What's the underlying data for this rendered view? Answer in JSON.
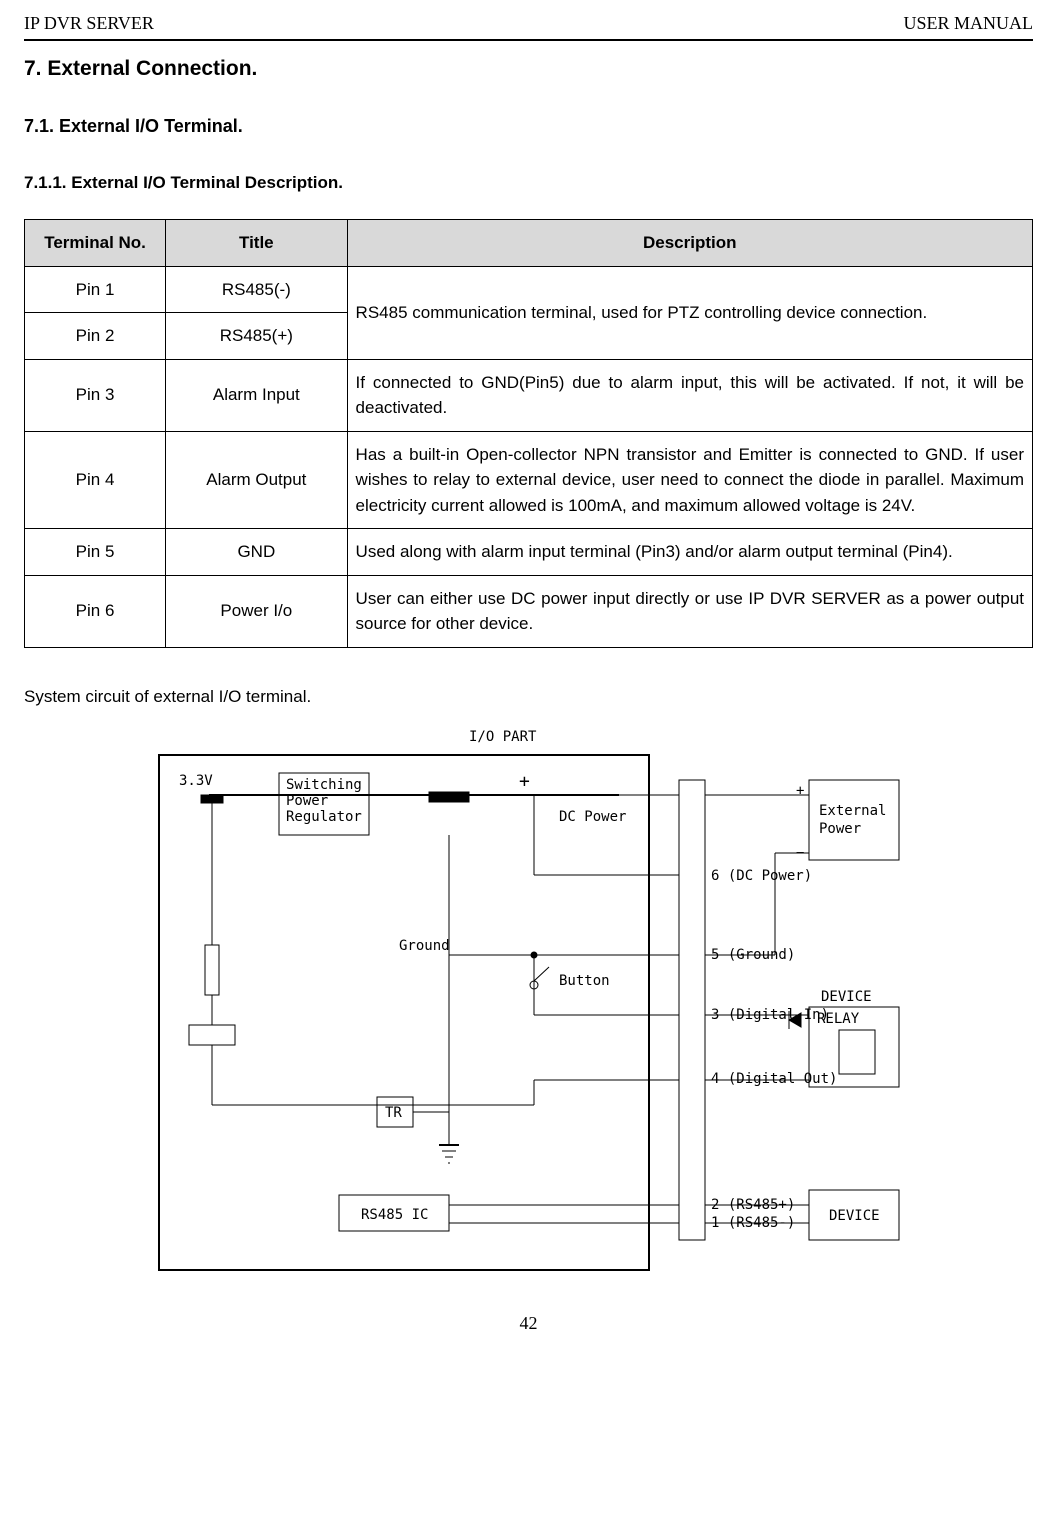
{
  "header": {
    "left": "IP DVR SERVER",
    "right": "USER MANUAL"
  },
  "headings": {
    "h1": "7. External Connection.",
    "h2": "7.1. External I/O Terminal.",
    "h3": "7.1.1.  External I/O Terminal Description."
  },
  "table": {
    "headers": {
      "col1": "Terminal No.",
      "col2": "Title",
      "col3": "Description"
    },
    "rows": [
      {
        "no": "Pin 1",
        "title": "RS485(-)"
      },
      {
        "no": "Pin 2",
        "title": "RS485(+)"
      },
      {
        "no": "Pin 3",
        "title": "Alarm Input",
        "desc": "If connected to GND(Pin5) due to alarm input, this will be activated. If not, it will be deactivated."
      },
      {
        "no": "Pin 4",
        "title": "Alarm Output",
        "desc": "Has a built-in Open-collector NPN transistor and Emitter is connected to GND. If user wishes to relay to external device, user need to connect the diode in parallel.\nMaximum electricity current allowed is 100mA, and maximum allowed voltage is 24V."
      },
      {
        "no": "Pin 5",
        "title": "GND",
        "desc": "Used along with alarm input terminal (Pin3) and/or alarm output terminal (Pin4)."
      },
      {
        "no": "Pin 6",
        "title": "Power I/o",
        "desc": "User can either use DC power input directly or use IP DVR SERVER as a power output source for other device."
      }
    ],
    "rs485_desc": "RS485 communication terminal, used for PTZ controlling device connection."
  },
  "caption": "System circuit of external I/O terminal.",
  "diagram": {
    "title": "I/O PART",
    "v33": "3.3V",
    "spr": "Switching\nPower\nRegulator",
    "ground": "Ground",
    "tr": "TR",
    "rs485ic": "RS485 IC",
    "dcpower": "DC Power",
    "plus": "+",
    "pin6": "6 (DC Power)",
    "pin5": "5 (Ground)",
    "button": "Button",
    "pin3": "3 (Digital In)",
    "pin4": "4 (Digital Out)",
    "pin2": "2 (RS485+)",
    "pin1": "1 (RS485-)",
    "extpower": "External\nPower",
    "extplus": "+",
    "extminus": "−",
    "device": "DEVICE",
    "relay": "RELAY"
  },
  "page": "42"
}
